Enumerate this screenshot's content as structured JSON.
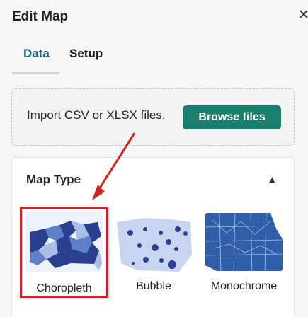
{
  "header": {
    "title": "Edit Map",
    "close_icon": "close-icon"
  },
  "tabs": [
    {
      "label": "Data",
      "active": true
    },
    {
      "label": "Setup",
      "active": false
    }
  ],
  "upload": {
    "text": "Import CSV or XLSX files.",
    "button_label": "Browse files"
  },
  "map_type": {
    "title": "Map Type",
    "collapse_icon": "chevron-up-icon",
    "options": [
      {
        "label": "Choropleth",
        "selected": true
      },
      {
        "label": "Bubble",
        "selected": false
      },
      {
        "label": "Monochrome",
        "selected": false
      }
    ]
  },
  "colors": {
    "accent": "#1a7f6e",
    "selection": "#d3231f",
    "map_dark": "#2a3f8f",
    "map_mid": "#5f7fc8",
    "map_light": "#a9bde5"
  }
}
